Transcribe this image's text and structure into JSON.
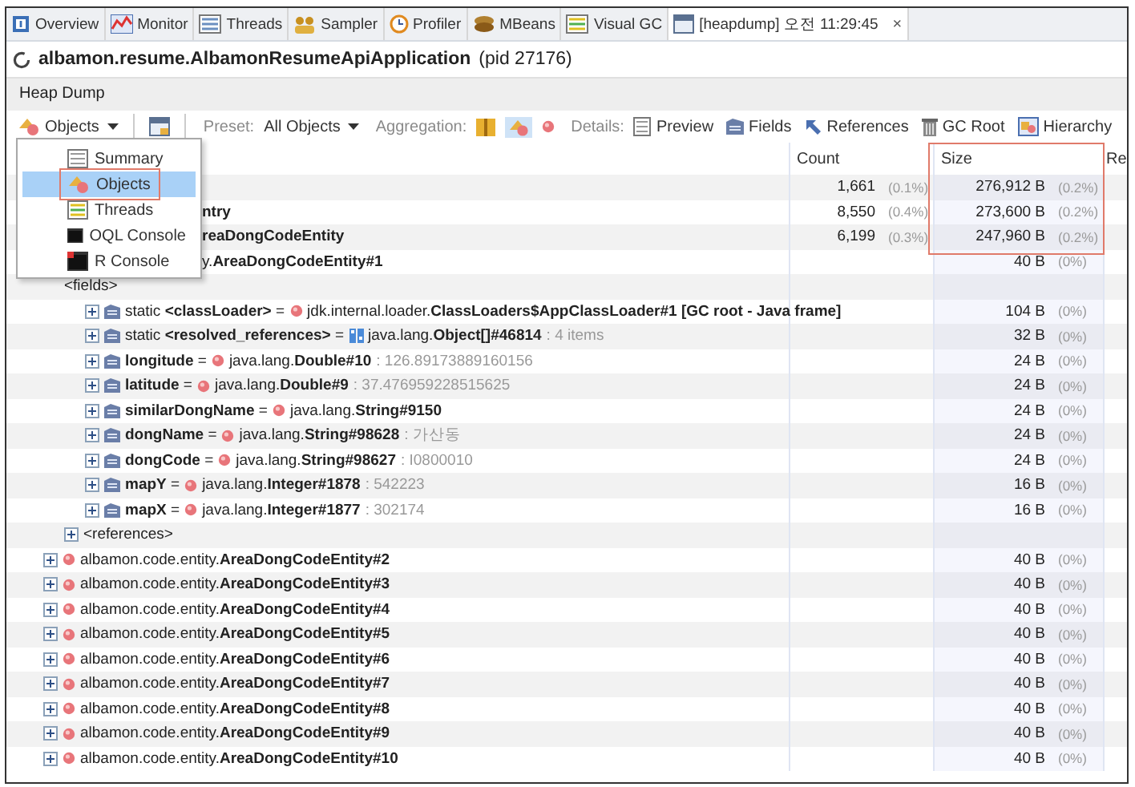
{
  "tabs": [
    {
      "label": "Overview",
      "selected": false
    },
    {
      "label": "Monitor",
      "selected": false
    },
    {
      "label": "Threads",
      "selected": false
    },
    {
      "label": "Sampler",
      "selected": false
    },
    {
      "label": "Profiler",
      "selected": false
    },
    {
      "label": "MBeans",
      "selected": false
    },
    {
      "label": "Visual GC",
      "selected": false
    },
    {
      "label": "[heapdump] 오전 11:29:45",
      "selected": true,
      "close": "×"
    }
  ],
  "title": {
    "app": "albamon.resume.AlbamonResumeApiApplication",
    "pid": "(pid 27176)"
  },
  "section": "Heap Dump",
  "toolbar": {
    "view": "Objects",
    "preset_label": "Preset:",
    "preset": "All Objects",
    "aggregation_label": "Aggregation:",
    "aggregation": [
      {
        "selected": false
      },
      {
        "selected": true
      },
      {
        "selected": false
      }
    ],
    "details_label": "Details:",
    "details": [
      {
        "label": "Preview"
      },
      {
        "label": "Fields"
      },
      {
        "label": "References"
      },
      {
        "label": "GC Root"
      },
      {
        "label": "Hierarchy"
      }
    ]
  },
  "menu": {
    "items": [
      {
        "label": "Summary",
        "selected": false
      },
      {
        "label": "Objects",
        "selected": true,
        "highlighted": true
      },
      {
        "label": "Threads",
        "selected": false
      },
      {
        "label": "OQL Console",
        "selected": false
      },
      {
        "label": "R Console",
        "selected": false
      }
    ]
  },
  "table": {
    "columns": [
      {
        "label": "Count"
      },
      {
        "label": "Size",
        "highlighted": true
      },
      {
        "label": "Re"
      }
    ],
    "rows": [
      {
        "kind": "class",
        "count": "1,661",
        "count_pct": "(0.1%)",
        "size": "276,912 B",
        "size_pct": "(0.2%)"
      },
      {
        "kind": "class",
        "covered_left": true,
        "name": "ntry",
        "count": "8,550",
        "count_pct": "(0.4%)",
        "size": "273,600 B",
        "size_pct": "(0.2%)"
      },
      {
        "kind": "class",
        "covered_left": true,
        "name": "reaDongCodeEntity",
        "count": "6,199",
        "count_pct": "(0.3%)",
        "size": "247,960 B",
        "size_pct": "(0.2%)",
        "children": [
          {
            "kind": "instance",
            "covered_left": true,
            "name": "y.**AreaDongCodeEntity#1**",
            "size": "40 B",
            "size_pct": "(0%)",
            "children": [
              {
                "kind": "group",
                "name": "<fields>",
                "children": [
                  {
                    "kind": "object_field",
                    "expanded": false,
                    "decl": "static **<classLoader>** =",
                    "ref": "jdk.internal.loader.**ClassLoaders$AppClassLoader#1 [GC root - Java frame]**",
                    "size": "104 B",
                    "size_pct": "(0%)"
                  },
                  {
                    "kind": "array_field",
                    "expanded": false,
                    "decl": "static **<resolved_references>** =",
                    "ref": "java.lang.**Object[]#46814**",
                    "value": ": 4 items",
                    "size": "32 B",
                    "size_pct": "(0%)"
                  },
                  {
                    "kind": "object_field",
                    "expanded": false,
                    "decl": "**longitude** =",
                    "ref": "java.lang.**Double#10**",
                    "value": ": 126.89173889160156",
                    "size": "24 B",
                    "size_pct": "(0%)"
                  },
                  {
                    "kind": "object_field",
                    "expanded": false,
                    "decl": "**latitude** =",
                    "ref": "java.lang.**Double#9**",
                    "value": ": 37.476959228515625",
                    "size": "24 B",
                    "size_pct": "(0%)"
                  },
                  {
                    "kind": "object_field",
                    "expanded": false,
                    "decl": "**similarDongName** =",
                    "ref": "java.lang.**String#9150**",
                    "size": "24 B",
                    "size_pct": "(0%)"
                  },
                  {
                    "kind": "object_field",
                    "expanded": false,
                    "decl": "**dongName** =",
                    "ref": "java.lang.**String#98628**",
                    "value": ": 가산동",
                    "size": "24 B",
                    "size_pct": "(0%)"
                  },
                  {
                    "kind": "object_field",
                    "expanded": false,
                    "decl": "**dongCode** =",
                    "ref": "java.lang.**String#98627**",
                    "value": ": I0800010",
                    "size": "24 B",
                    "size_pct": "(0%)"
                  },
                  {
                    "kind": "object_field",
                    "expanded": false,
                    "decl": "**mapY** =",
                    "ref": "java.lang.**Integer#1878**",
                    "value": ": 542223",
                    "size": "16 B",
                    "size_pct": "(0%)"
                  },
                  {
                    "kind": "object_field",
                    "expanded": false,
                    "decl": "**mapX** =",
                    "ref": "java.lang.**Integer#1877**",
                    "value": ": 302174",
                    "size": "16 B",
                    "size_pct": "(0%)"
                  }
                ]
              },
              {
                "kind": "group",
                "expanded": false,
                "name": "<references>"
              }
            ]
          },
          {
            "kind": "instance",
            "covered_left": false,
            "expanded": false,
            "name": "albamon.code.entity.**AreaDongCodeEntity#2**",
            "size": "40 B",
            "size_pct": "(0%)"
          },
          {
            "kind": "instance",
            "covered_left": false,
            "expanded": false,
            "name": "albamon.code.entity.**AreaDongCodeEntity#3**",
            "size": "40 B",
            "size_pct": "(0%)"
          },
          {
            "kind": "instance",
            "covered_left": false,
            "expanded": false,
            "name": "albamon.code.entity.**AreaDongCodeEntity#4**",
            "size": "40 B",
            "size_pct": "(0%)"
          },
          {
            "kind": "instance",
            "covered_left": false,
            "expanded": false,
            "name": "albamon.code.entity.**AreaDongCodeEntity#5**",
            "size": "40 B",
            "size_pct": "(0%)"
          },
          {
            "kind": "instance",
            "covered_left": false,
            "expanded": false,
            "name": "albamon.code.entity.**AreaDongCodeEntity#6**",
            "size": "40 B",
            "size_pct": "(0%)"
          },
          {
            "kind": "instance",
            "covered_left": false,
            "expanded": false,
            "name": "albamon.code.entity.**AreaDongCodeEntity#7**",
            "size": "40 B",
            "size_pct": "(0%)"
          },
          {
            "kind": "instance",
            "covered_left": false,
            "expanded": false,
            "name": "albamon.code.entity.**AreaDongCodeEntity#8**",
            "size": "40 B",
            "size_pct": "(0%)"
          },
          {
            "kind": "instance",
            "covered_left": false,
            "expanded": false,
            "name": "albamon.code.entity.**AreaDongCodeEntity#9**",
            "size": "40 B",
            "size_pct": "(0%)"
          },
          {
            "kind": "instance",
            "covered_left": false,
            "expanded": false,
            "name": "albamon.code.entity.**AreaDongCodeEntity#10**",
            "size": "40 B",
            "size_pct": "(0%)"
          }
        ]
      }
    ]
  }
}
